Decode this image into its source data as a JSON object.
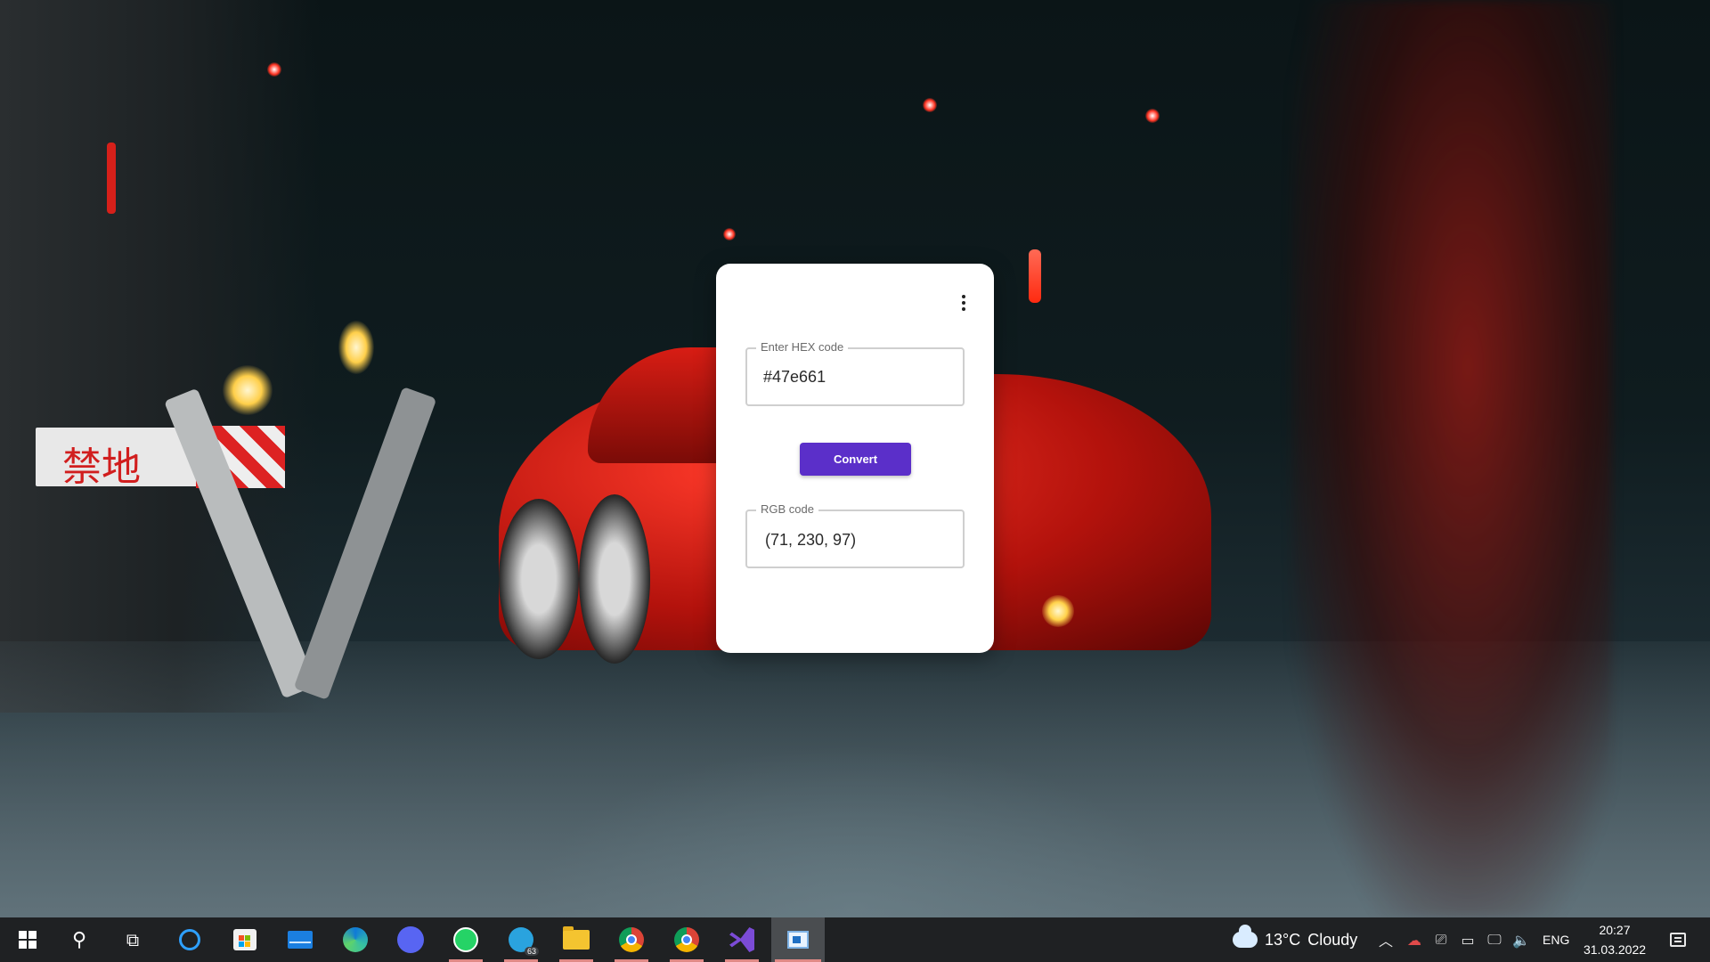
{
  "app": {
    "hex_label": "Enter HEX code",
    "hex_value": "#47e661",
    "convert_label": "Convert",
    "rgb_label": "RGB code",
    "rgb_value": "(71, 230, 97)",
    "menu_icon": "more-vert-icon",
    "accent_color": "#5b2fc9"
  },
  "wallpaper": {
    "sign_text": "禁地"
  },
  "taskbar": {
    "apps": [
      {
        "name": "start",
        "icon": "windows-icon"
      },
      {
        "name": "search",
        "icon": "search-icon"
      },
      {
        "name": "task-view",
        "icon": "task-view-icon"
      },
      {
        "name": "cortana",
        "icon": "cortana-icon"
      },
      {
        "name": "microsoft-store",
        "icon": "store-icon"
      },
      {
        "name": "mail",
        "icon": "mail-icon"
      },
      {
        "name": "edge",
        "icon": "edge-icon"
      },
      {
        "name": "discord",
        "icon": "discord-icon"
      },
      {
        "name": "whatsapp",
        "icon": "whatsapp-icon"
      },
      {
        "name": "telegram",
        "icon": "telegram-icon",
        "badge": "63"
      },
      {
        "name": "file-explorer",
        "icon": "folder-icon"
      },
      {
        "name": "chrome-profile",
        "icon": "chrome-icon"
      },
      {
        "name": "chrome",
        "icon": "chrome-icon"
      },
      {
        "name": "visual-studio",
        "icon": "visual-studio-icon"
      },
      {
        "name": "hex-converter",
        "icon": "app-icon"
      }
    ],
    "weather": {
      "temp": "13°C",
      "condition": "Cloudy"
    },
    "language": "ENG",
    "time": "20:27",
    "date": "31.03.2022"
  }
}
